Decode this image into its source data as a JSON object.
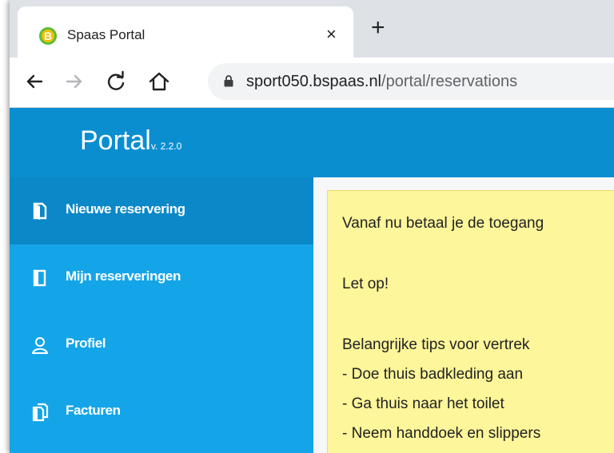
{
  "browser": {
    "tab": {
      "title": "Spaas Portal",
      "favicon_letter": "B",
      "close_glyph": "×"
    },
    "new_tab_glyph": "+",
    "address": {
      "host": "sport050.bspaas.nl",
      "path": "/portal/reservations"
    }
  },
  "app": {
    "brand": {
      "name": "Portal",
      "version": "v. 2.2.0"
    },
    "sidebar": {
      "items": [
        {
          "label": "Nieuwe reservering",
          "icon": "new-reservation-icon",
          "active": true
        },
        {
          "label": "Mijn reserveringen",
          "icon": "book-icon",
          "active": false
        },
        {
          "label": "Profiel",
          "icon": "user-icon",
          "active": false
        },
        {
          "label": "Facturen",
          "icon": "invoices-icon",
          "active": false
        }
      ]
    },
    "notice": {
      "lines": [
        "Vanaf nu betaal je de toegang",
        "Let op!",
        "Belangrijke tips voor vertrek",
        "- Doe thuis badkleding aan",
        "- Ga thuis naar het toilet",
        "- Neem handdoek en slippers"
      ]
    }
  },
  "colors": {
    "header": "#0a8ed0",
    "sidebar": "#14a5e8",
    "sidebar_active": "#0a88c8",
    "notice_bg": "#fdf69a"
  }
}
